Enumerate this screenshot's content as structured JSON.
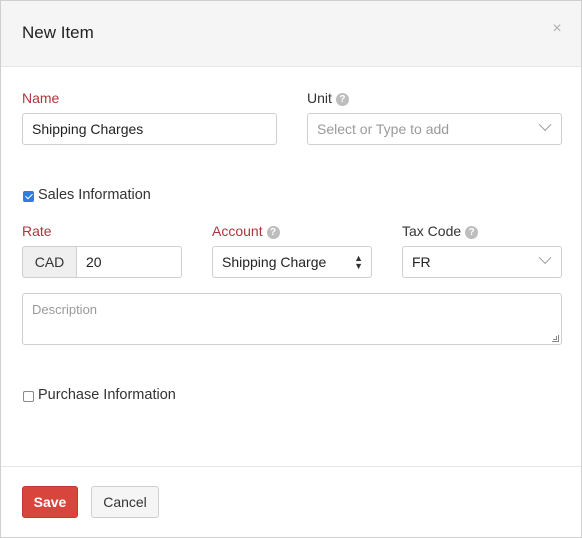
{
  "modal": {
    "title": "New Item",
    "close_glyph": "×"
  },
  "form": {
    "name": {
      "label": "Name",
      "value": "Shipping Charges"
    },
    "unit": {
      "label": "Unit",
      "placeholder": "Select or Type to add"
    },
    "sales_section": {
      "label": "Sales Information",
      "checked": true
    },
    "rate": {
      "label": "Rate",
      "currency": "CAD",
      "value": "20"
    },
    "account": {
      "label": "Account",
      "value": "Shipping Charge"
    },
    "tax_code": {
      "label": "Tax Code",
      "value": "FR"
    },
    "description": {
      "placeholder": "Description"
    },
    "purchase_section": {
      "label": "Purchase Information",
      "checked": false
    }
  },
  "help_glyph": "?",
  "actions": {
    "save_label": "Save",
    "cancel_label": "Cancel"
  },
  "colors": {
    "required_label": "#b0343c",
    "primary_button": "#d8453c",
    "checkbox_checked": "#2f7de1"
  },
  "icons": {
    "help": "question-circle-icon",
    "close": "close-icon",
    "dropdown": "chevron-down-icon",
    "select_arrows": "updown-arrows-icon",
    "check": "checkmark-icon"
  }
}
